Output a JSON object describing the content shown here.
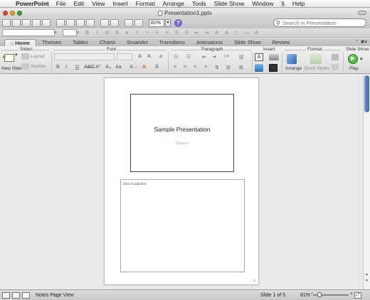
{
  "menubar": {
    "app": "PowerPoint",
    "items": [
      "File",
      "Edit",
      "View",
      "Insert",
      "Format",
      "Arrange",
      "Tools",
      "Slide Show",
      "Window",
      "Help"
    ]
  },
  "window": {
    "title": "Presentation1.pptx"
  },
  "toolbar": {
    "zoom_value": "81%",
    "search_placeholder": "Search in Presentation"
  },
  "ribbon": {
    "tabs": [
      "Home",
      "Themes",
      "Tables",
      "Charts",
      "SmartArt",
      "Transitions",
      "Animations",
      "Slide Show",
      "Review"
    ],
    "active_tab": "Home",
    "groups": {
      "slides": "Slides",
      "font": "Font",
      "paragraph": "Paragraph",
      "insert": "Insert",
      "format": "Format",
      "slide_show": "Slide Show"
    },
    "buttons": {
      "new_slide": "New Slide",
      "layout": "Layout",
      "section": "Section",
      "arrange": "Arrange",
      "quick_styles": "Quick Styles",
      "play": "Play"
    }
  },
  "page": {
    "slide_title": "Sample Presentation",
    "slide_subtitle": "Shapes",
    "notes_placeholder": "Click to add text",
    "page_number": "1"
  },
  "statusbar": {
    "view_name": "Notes Page View",
    "slide_counter": "Slide 1 of 5",
    "zoom": "81%"
  },
  "colors": {
    "active_scroll": "#3b6bb3",
    "play_button": "#3aa535",
    "close_button": "#e0443e"
  }
}
